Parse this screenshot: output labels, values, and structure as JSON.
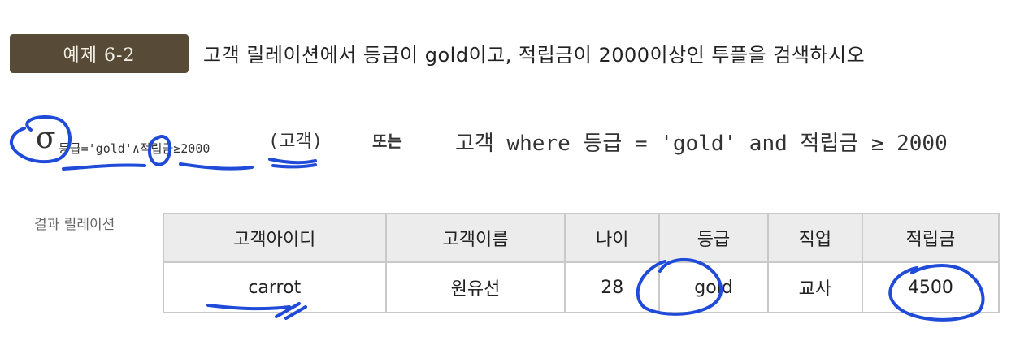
{
  "badge": {
    "label": "예제 6-2"
  },
  "question": {
    "text": "고객 릴레이션에서 등급이 gold이고, 적립금이 2000이상인 투플을 검색하시오"
  },
  "formula": {
    "sigma": "σ",
    "predicate": "등급='gold'∧적립금≥2000",
    "relation": "(고객)",
    "or_word": "또는",
    "sql": "고객 where 등급 = 'gold' and 적립금 ≥ 2000"
  },
  "result": {
    "label": "결과 릴레이션",
    "headers": [
      "고객아이디",
      "고객이름",
      "나이",
      "등급",
      "직업",
      "적립금"
    ],
    "rows": [
      [
        "carrot",
        "원유선",
        "28",
        "gold",
        "교사",
        "4500"
      ]
    ]
  },
  "colors": {
    "badge_bg": "#574b38",
    "header_bg": "#ececec",
    "annotation_ink": "#1f4bd8"
  }
}
